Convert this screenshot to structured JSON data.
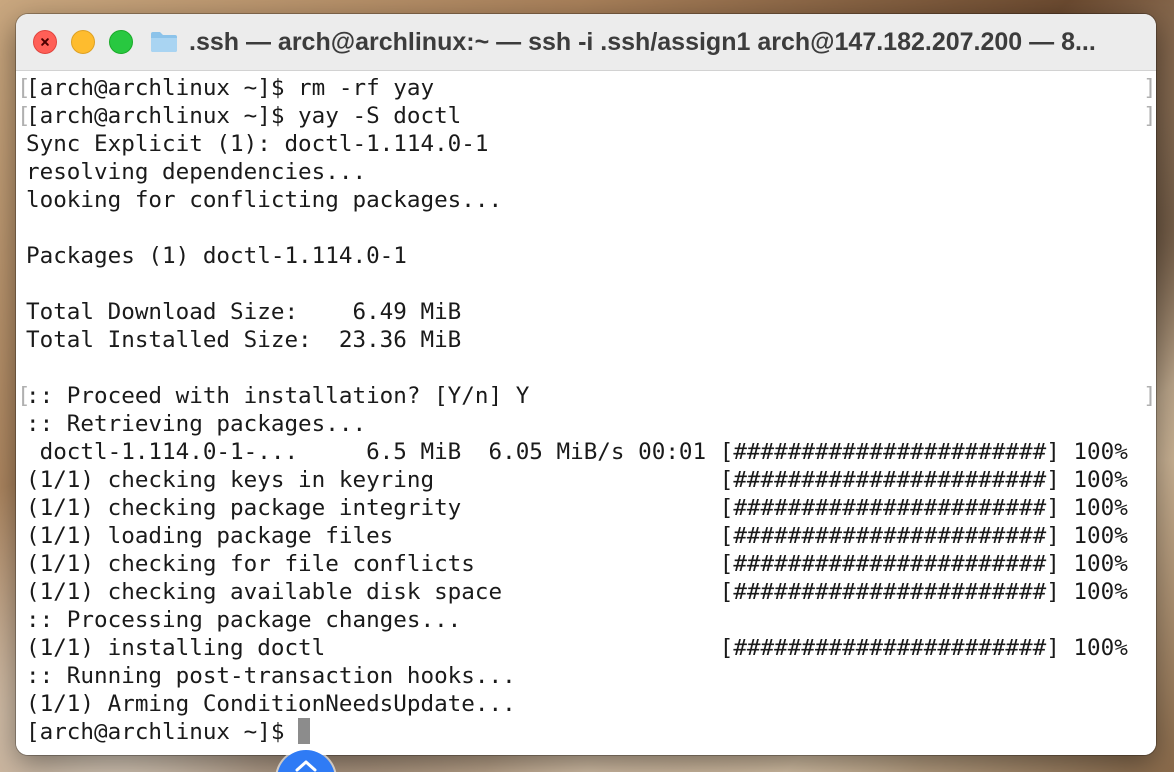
{
  "window": {
    "title": ".ssh — arch@archlinux:~ — ssh -i .ssh/assign1 arch@147.182.207.200 — 8..."
  },
  "terminal": {
    "lines": [
      {
        "text": "[arch@archlinux ~]$ rm -rf yay",
        "marked": true
      },
      {
        "text": "[arch@archlinux ~]$ yay -S doctl",
        "marked": true
      },
      {
        "text": "Sync Explicit (1): doctl-1.114.0-1"
      },
      {
        "text": "resolving dependencies..."
      },
      {
        "text": "looking for conflicting packages..."
      },
      {
        "text": ""
      },
      {
        "text": "Packages (1) doctl-1.114.0-1"
      },
      {
        "text": ""
      },
      {
        "text": "Total Download Size:    6.49 MiB"
      },
      {
        "text": "Total Installed Size:  23.36 MiB"
      },
      {
        "text": ""
      },
      {
        "text": ":: Proceed with installation? [Y/n] Y",
        "marked": true
      },
      {
        "text": ":: Retrieving packages..."
      },
      {
        "text": " doctl-1.114.0-1-...     6.5 MiB  6.05 MiB/s 00:01 [#######################] 100%"
      },
      {
        "text": "(1/1) checking keys in keyring                     [#######################] 100%"
      },
      {
        "text": "(1/1) checking package integrity                   [#######################] 100%"
      },
      {
        "text": "(1/1) loading package files                        [#######################] 100%"
      },
      {
        "text": "(1/1) checking for file conflicts                  [#######################] 100%"
      },
      {
        "text": "(1/1) checking available disk space                [#######################] 100%"
      },
      {
        "text": ":: Processing package changes..."
      },
      {
        "text": "(1/1) installing doctl                             [#######################] 100%"
      },
      {
        "text": ":: Running post-transaction hooks..."
      },
      {
        "text": "(1/1) Arming ConditionNeedsUpdate..."
      }
    ],
    "prompt": "[arch@archlinux ~]$ "
  },
  "colors": {
    "close": "#ff5f57",
    "minimize": "#febc2e",
    "maximize": "#28c840",
    "accent": "#2f7bf5"
  },
  "icons": [
    "close-icon",
    "folder-icon",
    "chevron-up-icon"
  ]
}
